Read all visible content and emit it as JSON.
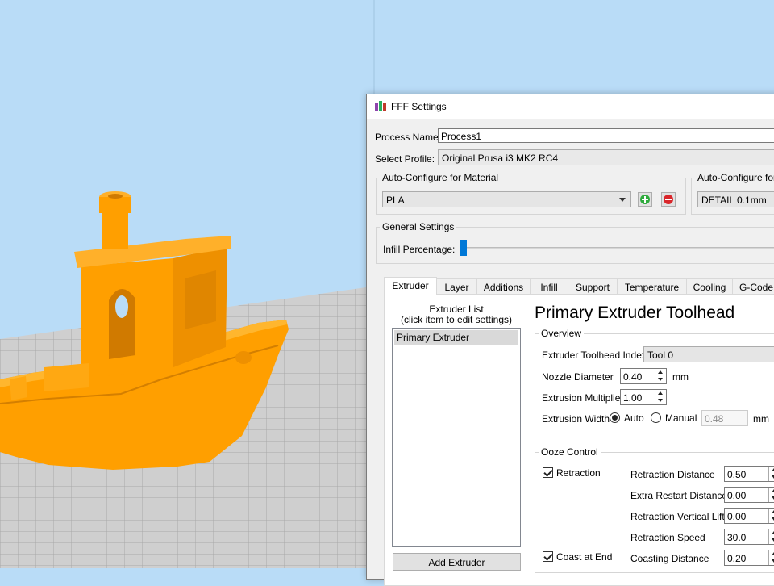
{
  "dialog": {
    "title": "FFF Settings",
    "process_name_label": "Process Name:",
    "process_name_value": "Process1",
    "select_profile_label": "Select Profile:",
    "select_profile_value": "Original Prusa i3 MK2 RC4",
    "auto_material": {
      "title": "Auto-Configure for Material",
      "value": "PLA"
    },
    "auto_quality": {
      "title": "Auto-Configure for Print Quality",
      "value": "DETAIL 0.1mm"
    },
    "general": {
      "title": "General Settings",
      "infill_label": "Infill Percentage:",
      "infill_percent": 0
    },
    "tabs": [
      "Extruder",
      "Layer",
      "Additions",
      "Infill",
      "Support",
      "Temperature",
      "Cooling",
      "G-Code"
    ],
    "active_tab": "Extruder",
    "extruder_list": {
      "title": "Extruder List\n(click item to edit settings)",
      "title_line1": "Extruder List",
      "title_line2": "(click item to edit settings)",
      "items": [
        "Primary Extruder"
      ],
      "add_button": "Add Extruder"
    },
    "toolhead": {
      "heading": "Primary Extruder Toolhead",
      "overview_title": "Overview",
      "index_label": "Extruder Toolhead Index",
      "index_value": "Tool 0",
      "nozzle_label": "Nozzle Diameter",
      "nozzle_value": "0.40",
      "nozzle_unit": "mm",
      "multiplier_label": "Extrusion Multiplier",
      "multiplier_value": "1.00",
      "width_label": "Extrusion Width",
      "width_auto": "Auto",
      "width_manual": "Manual",
      "width_value": "0.48",
      "width_unit": "mm"
    },
    "ooze": {
      "title": "Ooze Control",
      "retraction_label": "Retraction",
      "retraction_checked": true,
      "coast_label": "Coast at End",
      "coast_checked": true,
      "rows": [
        {
          "label": "Retraction Distance",
          "value": "0.50"
        },
        {
          "label": "Extra Restart Distance",
          "value": "0.00"
        },
        {
          "label": "Retraction Vertical Lift",
          "value": "0.00"
        },
        {
          "label": "Retraction Speed",
          "value": "30.0"
        },
        {
          "label": "Coasting Distance",
          "value": "0.20"
        }
      ]
    }
  },
  "colors": {
    "model": "#ff9f00",
    "sky": "#b9dcf7",
    "floor": "#cfcfcf",
    "accent": "#0078d7"
  }
}
